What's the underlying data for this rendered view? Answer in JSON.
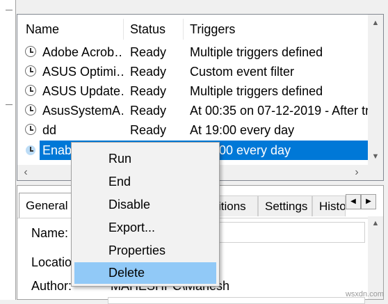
{
  "task_list": {
    "columns": [
      "Name",
      "Status",
      "Triggers"
    ],
    "rows": [
      {
        "name": "Adobe Acrob…",
        "status": "Ready",
        "triggers": "Multiple triggers defined"
      },
      {
        "name": "ASUS Optimi…",
        "status": "Ready",
        "triggers": "Custom event filter"
      },
      {
        "name": "ASUS Update…",
        "status": "Ready",
        "triggers": "Multiple triggers defined"
      },
      {
        "name": "AsusSystemA…",
        "status": "Ready",
        "triggers": "At 00:35 on 07-12-2019 - After tri"
      },
      {
        "name": "dd",
        "status": "Ready",
        "triggers": "At 19:00 every day"
      },
      {
        "name": "Enabl",
        "status": "",
        "triggers": "00 every day"
      }
    ],
    "selected_row": 5,
    "scroll_up_glyph": "▲",
    "scroll_down_glyph": "▼",
    "scroll_left_glyph": "‹",
    "scroll_right_glyph": "›"
  },
  "details_panel": {
    "tabs": [
      {
        "label": "General",
        "active": true
      },
      {
        "label": "itions",
        "active": false
      },
      {
        "label": "Settings",
        "active": false
      },
      {
        "label": "Histo",
        "active": false
      }
    ],
    "tab_left_glyph": "◀",
    "tab_right_glyph": "▶",
    "scroll_up_glyph": "▲",
    "fields": [
      {
        "label": "Name:",
        "value": ""
      },
      {
        "label": "Locatio",
        "value": ""
      },
      {
        "label": "Author:",
        "value": "MAHESHPC\\Mahesh"
      }
    ]
  },
  "context_menu": {
    "items": [
      {
        "label": "Run",
        "highlighted": false
      },
      {
        "label": "End",
        "highlighted": false
      },
      {
        "label": "Disable",
        "highlighted": false
      },
      {
        "label": "Export...",
        "highlighted": false
      },
      {
        "label": "Properties",
        "highlighted": false
      },
      {
        "label": "Delete",
        "highlighted": true
      }
    ]
  },
  "watermark": "wsxdn.com",
  "colors": {
    "selection": "#0078d7",
    "menu_highlight": "#91c9f7",
    "menu_background": "#f2f2f2"
  }
}
